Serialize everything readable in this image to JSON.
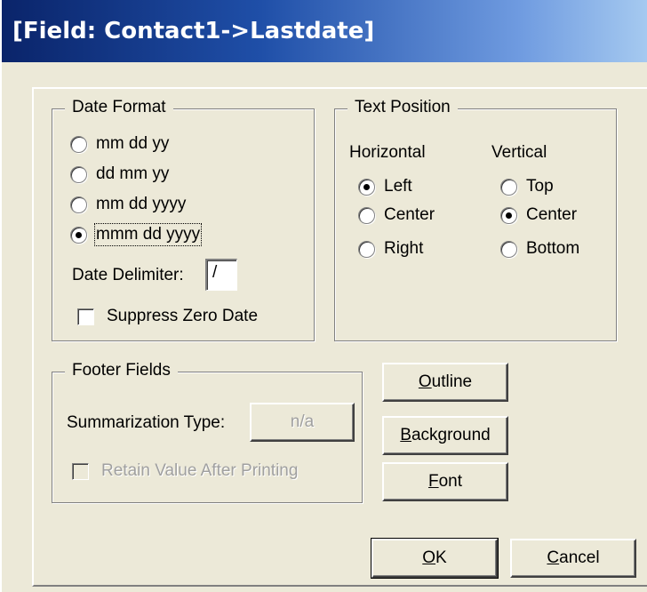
{
  "window": {
    "title": "[Field: Contact1->Lastdate]"
  },
  "date_format": {
    "legend": "Date Format",
    "options": [
      {
        "label": "mm dd yy",
        "checked": false
      },
      {
        "label": "dd mm yy",
        "checked": false
      },
      {
        "label": "mm dd yyyy",
        "checked": false
      },
      {
        "label": "mmm dd yyyy",
        "checked": true
      }
    ],
    "delimiter_label": "Date Delimiter:",
    "delimiter_value": "/",
    "suppress_zero_label": "Suppress Zero Date",
    "suppress_zero_checked": false
  },
  "text_position": {
    "legend": "Text Position",
    "horizontal_label": "Horizontal",
    "vertical_label": "Vertical",
    "horizontal_options": [
      {
        "label": "Left",
        "checked": true
      },
      {
        "label": "Center",
        "checked": false
      },
      {
        "label": "Right",
        "checked": false
      }
    ],
    "vertical_options": [
      {
        "label": "Top",
        "checked": false
      },
      {
        "label": "Center",
        "checked": true
      },
      {
        "label": "Bottom",
        "checked": false
      }
    ]
  },
  "footer_fields": {
    "legend": "Footer Fields",
    "summarization_label": "Summarization Type:",
    "summarization_value": "n/a",
    "retain_label": "Retain Value After Printing",
    "retain_checked": false,
    "retain_disabled": true
  },
  "buttons": {
    "outline": "Outline",
    "background": "Background",
    "font": "Font",
    "ok": "OK",
    "cancel": "Cancel"
  },
  "colors": {
    "dialog_bg": "#ece9d8",
    "title_gradient_start": "#0a246a",
    "title_gradient_end": "#a6caf0"
  }
}
